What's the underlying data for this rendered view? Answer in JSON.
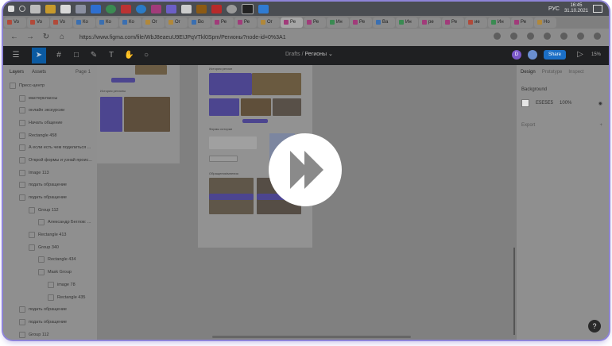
{
  "taskbar": {
    "clock_time": "16:45",
    "clock_date": "31.10.2021",
    "lang": "РУС",
    "icons": [
      "windows-icon",
      "search-icon",
      "taskview-icon",
      "folder-icon",
      "store-icon",
      "mail-icon",
      "check-icon",
      "chrome-icon",
      "music-icon",
      "skype-icon",
      "figma-icon",
      "discord-icon",
      "adobe-icon",
      "illustrator-icon",
      "photoshop-icon",
      "unity-icon",
      "pycharm-icon",
      "vscode-icon"
    ]
  },
  "browser": {
    "tabs": [
      "Vo",
      "Vo",
      "Vo",
      "Ко",
      "Ко",
      "Ко",
      "Ог",
      "Ог",
      "Во",
      "Ре",
      "Ре",
      "Ог",
      "Ре",
      "Ре",
      "Ин",
      "Ре",
      "Ва",
      "Ин",
      "ре",
      "Ре",
      "ие",
      "Ин",
      "Ре",
      "Но"
    ],
    "url": "https://www.figma.com/file/WbJ8eaeuU9EIJPqVTkl0Spm/Регионы?node-id=0%3A1"
  },
  "figma": {
    "breadcrumb_parent": "Drafts",
    "breadcrumb_sep": "/",
    "breadcrumb_file": "Регионы",
    "share_label": "Share",
    "zoom": "15%",
    "avatar_letter": "D",
    "layers_tab": "Layers",
    "assets_tab": "Assets",
    "page_selector": "Page 1",
    "layers": [
      "Пресс-центр",
      "мастерклассы",
      "онлайн экскурсии",
      "Начать общение",
      "Rectangle 458",
      "А если есть чем поделиться ...",
      "Открой формы и узнай проис...",
      "Image 113",
      "подать обращение",
      "подать обращение",
      "Group 112",
      "Александр Беглов: ...",
      "Rectangle 413",
      "Group 340",
      "Rectangle 434",
      "Mask Group",
      "image 78",
      "Rectangle 435",
      "подать обращение",
      "подать обращение",
      "Group 112"
    ],
    "inspector": {
      "tab_design": "Design",
      "tab_prototype": "Prototype",
      "tab_inspect": "Inspect",
      "background_label": "Background",
      "bg_hex": "E5E5E5",
      "bg_opacity": "100%",
      "export_label": "Export"
    },
    "canvas_text": {
      "a_caption": "История регионы",
      "b_heading": "История регион",
      "b_section2": "Формы истории",
      "b_section3": "Обращения/мнения"
    }
  }
}
